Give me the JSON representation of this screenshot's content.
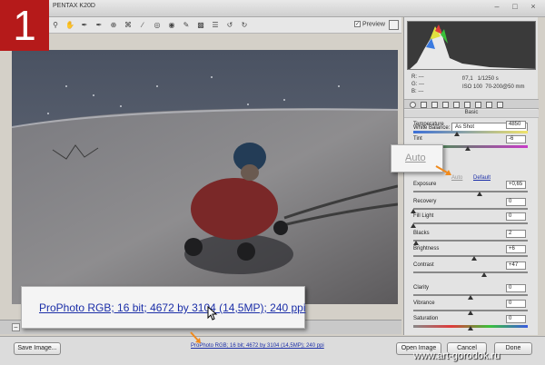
{
  "window": {
    "title": "PENTAX K20D",
    "logo_number": "1"
  },
  "toolbar": {
    "preview_label": "Preview",
    "preview_checked": true,
    "tools": [
      "zoom-icon",
      "hand-icon",
      "white-balance-icon",
      "color-sampler-icon",
      "target-adjust-icon",
      "crop-icon",
      "straighten-icon",
      "spot-removal-icon",
      "red-eye-icon",
      "adjustment-brush-icon",
      "graduated-filter-icon",
      "preferences-icon",
      "rotate-left-icon",
      "rotate-right-icon"
    ]
  },
  "info": {
    "r_label": "R:",
    "r_value": "---",
    "g_label": "G:",
    "g_value": "---",
    "b_label": "B:",
    "b_value": "---",
    "aperture": "f/7,1",
    "shutter": "1/1250 s",
    "iso": "ISO 100",
    "lens": "70-200@50 mm"
  },
  "panel": {
    "title": "Basic",
    "white_balance_label": "White Balance:",
    "white_balance_value": "As Shot",
    "auto_label": "Auto",
    "default_label": "Default",
    "sliders": [
      {
        "label": "Temperature",
        "value": "4850",
        "pos": 0.38
      },
      {
        "label": "Tint",
        "value": "-6",
        "pos": 0.48
      },
      {
        "label": "Exposure",
        "value": "+0,65",
        "pos": 0.58
      },
      {
        "label": "Recovery",
        "value": "0",
        "pos": 0.0
      },
      {
        "label": "Fill Light",
        "value": "0",
        "pos": 0.0
      },
      {
        "label": "Blacks",
        "value": "2",
        "pos": 0.02
      },
      {
        "label": "Brightness",
        "value": "+6",
        "pos": 0.53
      },
      {
        "label": "Contrast",
        "value": "+47",
        "pos": 0.62
      },
      {
        "label": "Clarity",
        "value": "0",
        "pos": 0.5
      },
      {
        "label": "Vibrance",
        "value": "0",
        "pos": 0.5
      },
      {
        "label": "Saturation",
        "value": "0",
        "pos": 0.5
      }
    ]
  },
  "callout": {
    "workflow_text": "ProPhoto RGB; 16 bit; 4672 by 3104 (14,5MP); 240 ppi",
    "auto_text": "Auto"
  },
  "bottom": {
    "save_label": "Save Image...",
    "workflow_link": "ProPhoto RGB; 16 bit; 4672 by 3104 (14,5MP); 240 ppi",
    "open_label": "Open Image",
    "cancel_label": "Cancel",
    "done_label": "Done"
  },
  "watermark": "www.art-gorodok.ru",
  "colors": {
    "logo_red": "#b51a1a",
    "link_blue": "#1c2fa8",
    "arrow_orange": "#f08a1c"
  }
}
